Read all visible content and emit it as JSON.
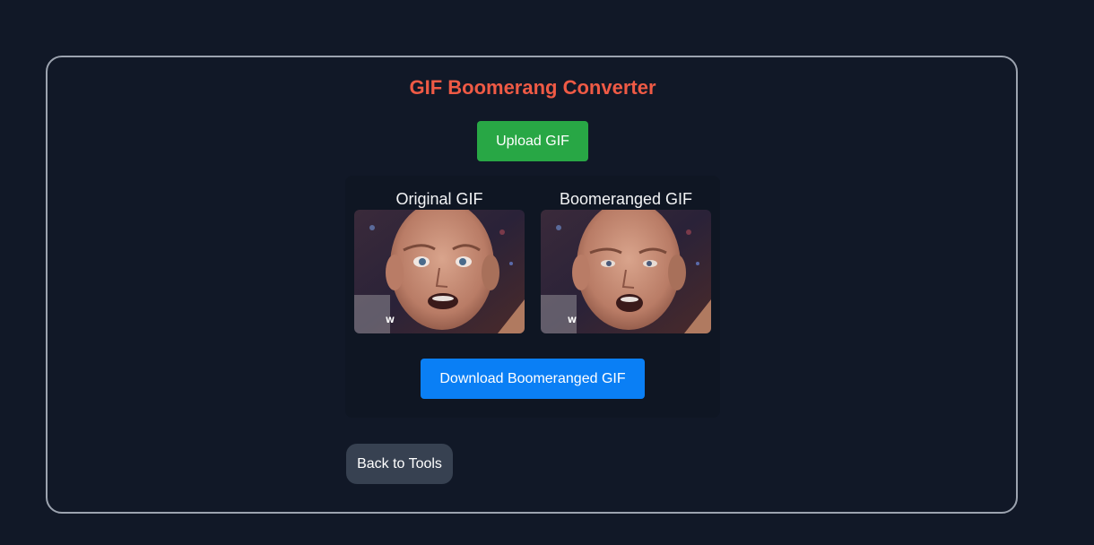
{
  "app": {
    "title": "GIF Boomerang Converter",
    "accent_color": "#ef5a45"
  },
  "actions": {
    "upload_label": "Upload GIF",
    "upload_color": "#28a745",
    "download_label": "Download Boomeranged GIF",
    "download_color": "#0a7ff5",
    "back_label": "Back to Tools"
  },
  "previews": [
    {
      "label": "Original GIF",
      "icon": "gif-preview-image"
    },
    {
      "label": "Boomeranged GIF",
      "icon": "gif-preview-image"
    }
  ]
}
